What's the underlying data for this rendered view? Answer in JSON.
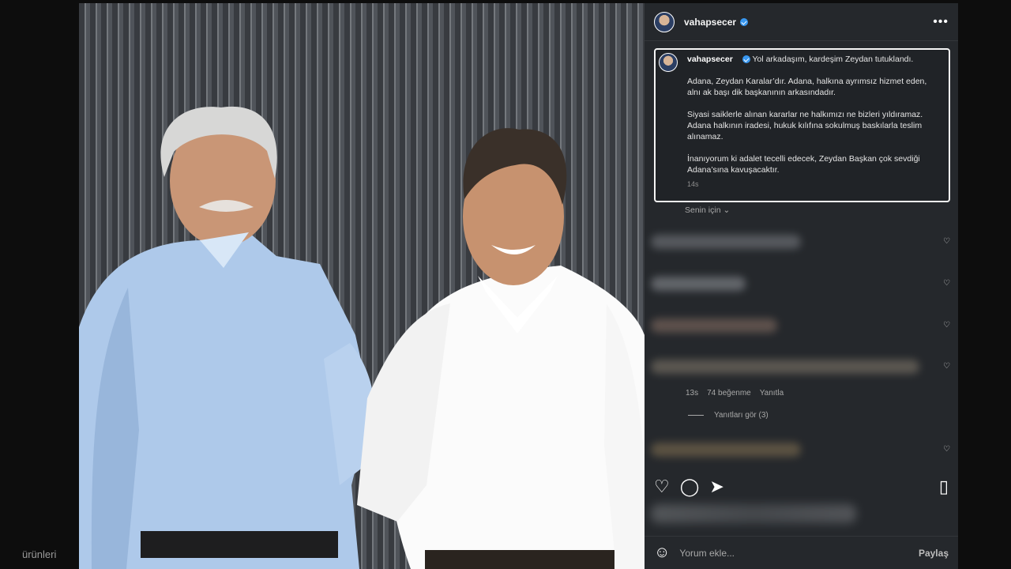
{
  "post": {
    "username": "vahapsecer",
    "caption_lines": [
      "Yol arkadaşım, kardeşim Zeydan tutuklandı.",
      "Adana, Zeydan Karalar’dır. Adana, halkına ayrımsız hizmet eden, alnı ak başı dik başkanının arkasındadır.",
      "Siyasi saiklerle alınan kararlar ne halkımızı ne bizleri yıldıramaz. Adana halkının iradesi, hukuk kılıfına sokulmuş baskılarla teslim alınamaz.",
      "İnanıyorum ki adalet tecelli edecek, Zeydan Başkan çok sevdiği Adana’sına kavuşacaktır."
    ],
    "time": "14s"
  },
  "comments": {
    "filter": "Senin için",
    "meta": {
      "time": "13s",
      "likes": "74 beğenme",
      "reply": "Yanıtla"
    },
    "replies": "Yanıtları gör (3)"
  },
  "composer": {
    "placeholder": "Yorum ekle...",
    "share": "Paylaş"
  },
  "background": {
    "partial_text": "ürünleri"
  },
  "icons": {
    "more": "more-icon",
    "like": "heart-icon",
    "comment": "comment-icon",
    "share": "send-icon",
    "save": "bookmark-icon",
    "emoji": "emoji-icon"
  },
  "colors": {
    "panel": "#25282c",
    "text": "#f5f5f5",
    "muted": "#a8a8a8",
    "verified": "#3897f0"
  }
}
